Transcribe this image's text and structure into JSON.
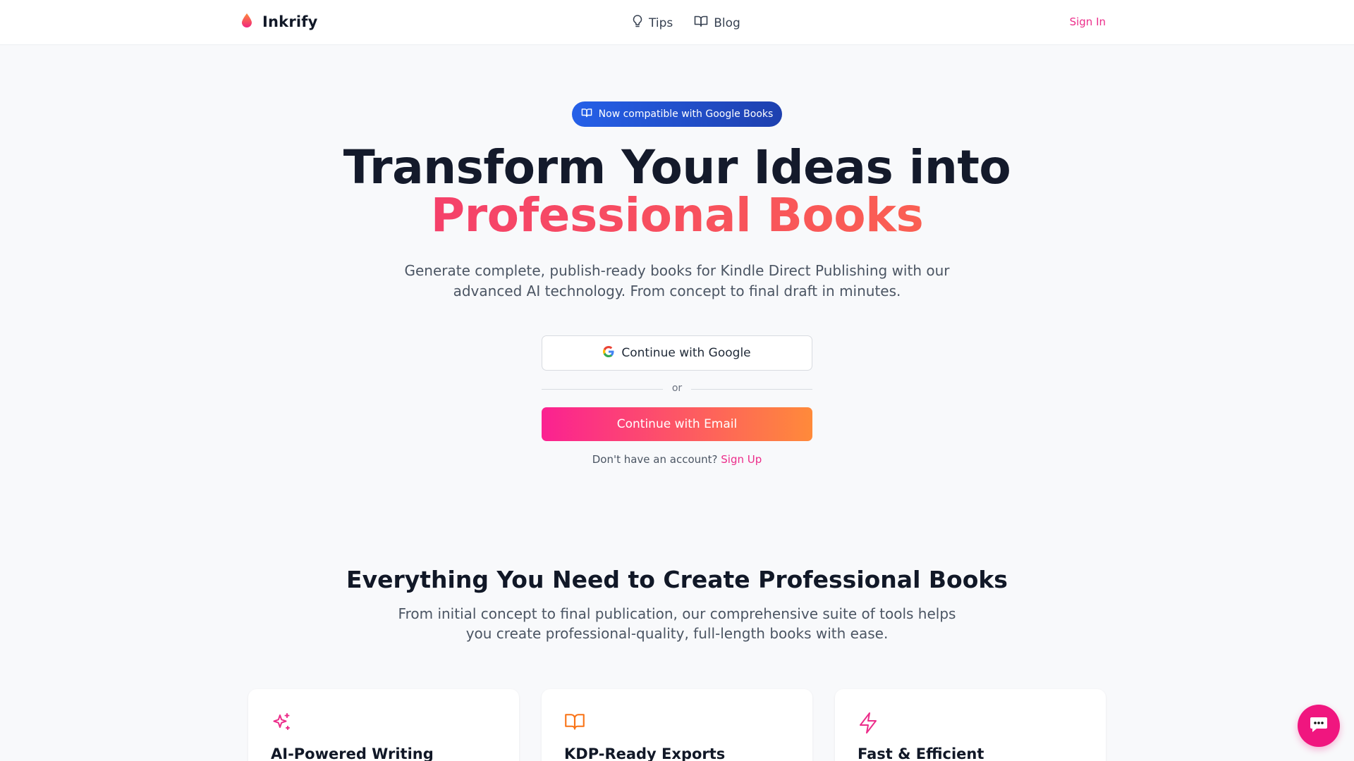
{
  "header": {
    "brand": "Inkrify",
    "nav": [
      {
        "label": "Tips",
        "icon": "lightbulb-icon"
      },
      {
        "label": "Blog",
        "icon": "book-open-icon"
      }
    ],
    "signin_label": "Sign In"
  },
  "hero": {
    "badge": "Now compatible with Google Books",
    "title_line1": "Transform Your Ideas into",
    "title_line2": "Professional Books",
    "subtitle": "Generate complete, publish-ready books for Kindle Direct Publishing with our advanced AI technology. From concept to final draft in minutes.",
    "google_button": "Continue with Google",
    "divider_text": "or",
    "email_button": "Continue with Email",
    "signup_prompt": "Don't have an account?",
    "signup_link": "Sign Up"
  },
  "features": {
    "title": "Everything You Need to Create Professional Books",
    "subtitle": "From initial concept to final publication, our comprehensive suite of tools helps you create professional-quality, full-length books with ease.",
    "cards": [
      {
        "title": "AI-Powered Writing",
        "icon": "sparkles-icon",
        "color": "#ec2d8a"
      },
      {
        "title": "KDP-Ready Exports",
        "icon": "book-open-icon",
        "color": "#f97316"
      },
      {
        "title": "Fast & Efficient",
        "icon": "lightning-icon",
        "color": "#ec2d8a"
      }
    ]
  },
  "colors": {
    "accent_pink": "#ec2d8a",
    "accent_orange": "#ff7a3e",
    "badge_blue": "#2560e8"
  },
  "chat": {
    "icon": "chat-bubble-icon"
  }
}
